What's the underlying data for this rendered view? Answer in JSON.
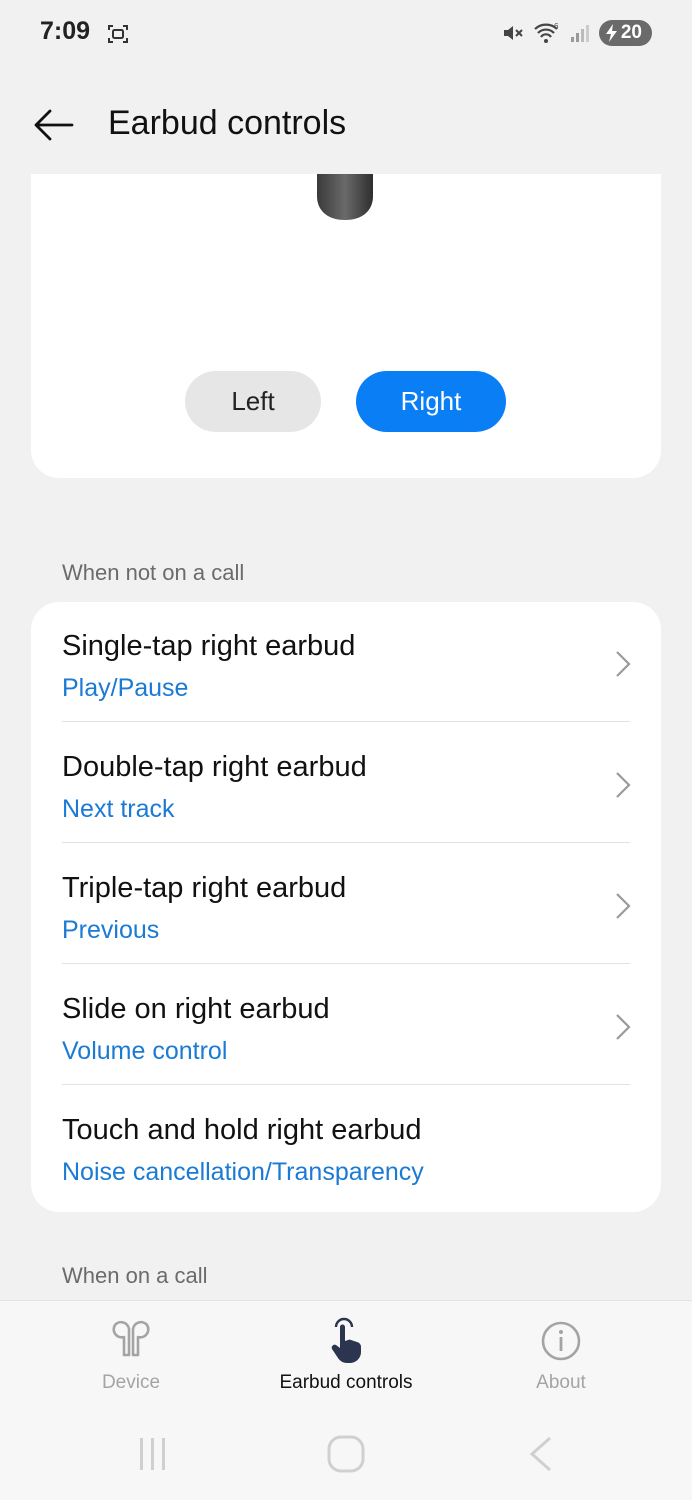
{
  "status_bar": {
    "time": "7:09",
    "battery": "20",
    "icons": [
      "screenshot-icon",
      "mute-icon",
      "wifi-icon",
      "signal-icon",
      "battery-icon"
    ]
  },
  "header": {
    "title": "Earbud controls",
    "back_icon": "arrow-left-icon"
  },
  "earbud_selector": {
    "left_label": "Left",
    "right_label": "Right",
    "selected": "Right"
  },
  "section_not_on_call": {
    "label": "When not on a call",
    "items": [
      {
        "title": "Single-tap right earbud",
        "value": "Play/Pause",
        "has_chevron": true
      },
      {
        "title": "Double-tap right earbud",
        "value": "Next track",
        "has_chevron": true
      },
      {
        "title": "Triple-tap right earbud",
        "value": "Previous",
        "has_chevron": true
      },
      {
        "title": "Slide on right earbud",
        "value": "Volume control",
        "has_chevron": true
      },
      {
        "title": "Touch and hold right earbud",
        "value": "Noise cancellation/Transparency",
        "has_chevron": false
      }
    ]
  },
  "section_on_call": {
    "label": "When on a call"
  },
  "bottom_nav": {
    "items": [
      {
        "label": "Device",
        "icon": "earbuds-icon",
        "active": false
      },
      {
        "label": "Earbud controls",
        "icon": "touch-hand-icon",
        "active": true
      },
      {
        "label": "About",
        "icon": "info-icon",
        "active": false
      }
    ]
  },
  "system_nav": {
    "buttons": [
      "recents-icon",
      "home-icon",
      "back-icon"
    ]
  },
  "colors": {
    "accent": "#0a7ef5",
    "value_text": "#1a7ad4",
    "background": "#f1f1f1",
    "card": "#ffffff"
  }
}
